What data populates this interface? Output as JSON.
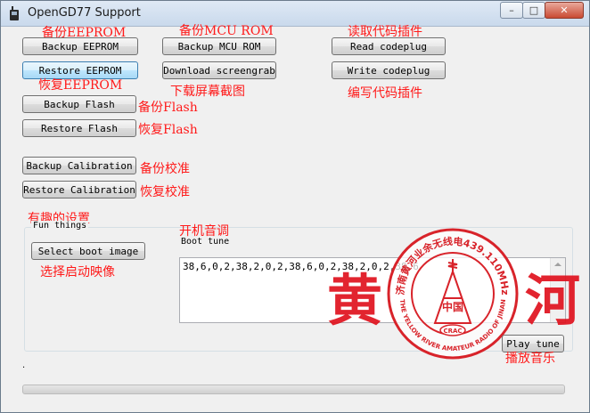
{
  "window": {
    "title": "OpenGD77 Support",
    "controls": {
      "minimize": "–",
      "maximize": "□",
      "close": "✕"
    }
  },
  "buttons": {
    "backup_eeprom": "Backup EEPROM",
    "restore_eeprom": "Restore EEPROM",
    "backup_flash": "Backup Flash",
    "restore_flash": "Restore Flash",
    "backup_calibration": "Backup Calibration",
    "restore_calibration": "Restore Calibration",
    "backup_mcu_rom": "Backup MCU ROM",
    "download_screengrab": "Download screengrab",
    "read_codeplug": "Read codeplug",
    "write_codeplug": "Write codeplug",
    "select_boot_image": "Select boot image",
    "play_tune": "Play tune"
  },
  "annotations": {
    "backup_eeprom": "备份EEPROM",
    "restore_eeprom": "恢复EEPROM",
    "backup_flash": "备份Flash",
    "restore_flash": "恢复Flash",
    "backup_calibration": "备份校准",
    "restore_calibration": "恢复校准",
    "backup_mcu_rom": "备份MCU ROM",
    "download_screengrab": "下载屏幕截图",
    "read_codeplug": "读取代码插件",
    "write_codeplug": "编写代码插件",
    "fun_things": "有趣的设置",
    "select_boot_image": "选择启动映像",
    "boot_tune": "开机音调",
    "play_tune": "播放音乐"
  },
  "fun_things": {
    "group_label": "Fun things",
    "boot_tune_label": "Boot tune",
    "boot_tune_value": "38,6,0,2,38,2,0,2,38,6,0,2,38,2,0,2,38,6"
  },
  "status_text": ".",
  "progress": {
    "percent": 0
  },
  "overlay": {
    "calligraphy_left": "黄",
    "calligraphy_right": "河",
    "seal_top_text": "济南黄河业余无线电439.110MHz",
    "seal_bottom_text": "THE YELLOW RIVER AMATEUR RADIO OF JINAN",
    "seal_center": "中国",
    "seal_badge": "CRAC"
  },
  "colors": {
    "annotation": "#ff1a1a",
    "seal": "#d8232a",
    "window_bg": "#f0f0f0"
  }
}
